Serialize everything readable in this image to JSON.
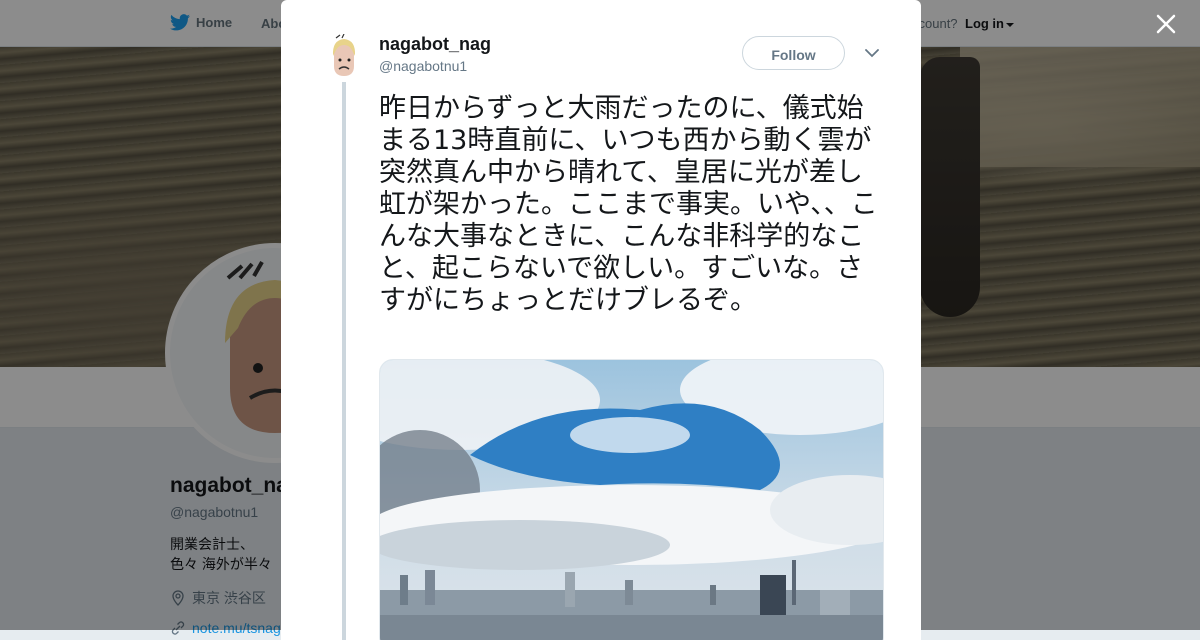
{
  "nav": {
    "home_label": "Home",
    "about_label": "Abo",
    "account_text": "ccount?",
    "login_label": "Log in"
  },
  "profile": {
    "name": "nagabot_na",
    "handle": "@nagabotnu1",
    "bio": "開業会計士、色々 海外が半々",
    "location": "東京 渋谷区",
    "link": "note.mu/tsnag"
  },
  "tweet": {
    "author_name": "nagabot_nag",
    "author_handle": "@nagabotnu1",
    "follow_label": "Follow",
    "text": "昨日からずっと大雨だったのに、儀式始まる13時直前に、いつも西から動く雲が突然真ん中から晴れて、皇居に光が差し虹が架かった。ここまで事実。いや、、こんな大事なときに、こんな非科学的なこと、起こらないで欲しい。すごいな。さすがにちょっとだけブレるぞ。"
  },
  "colors": {
    "twitter_blue": "#1da1f2",
    "text_dark": "#14171a",
    "text_muted": "#657786",
    "overlay": "rgba(0,0,0,0.45)"
  },
  "icons": {
    "bird": "twitter-bird-icon",
    "close": "close-icon",
    "chevron": "chevron-down-icon",
    "location": "location-pin-icon",
    "link": "link-icon"
  }
}
